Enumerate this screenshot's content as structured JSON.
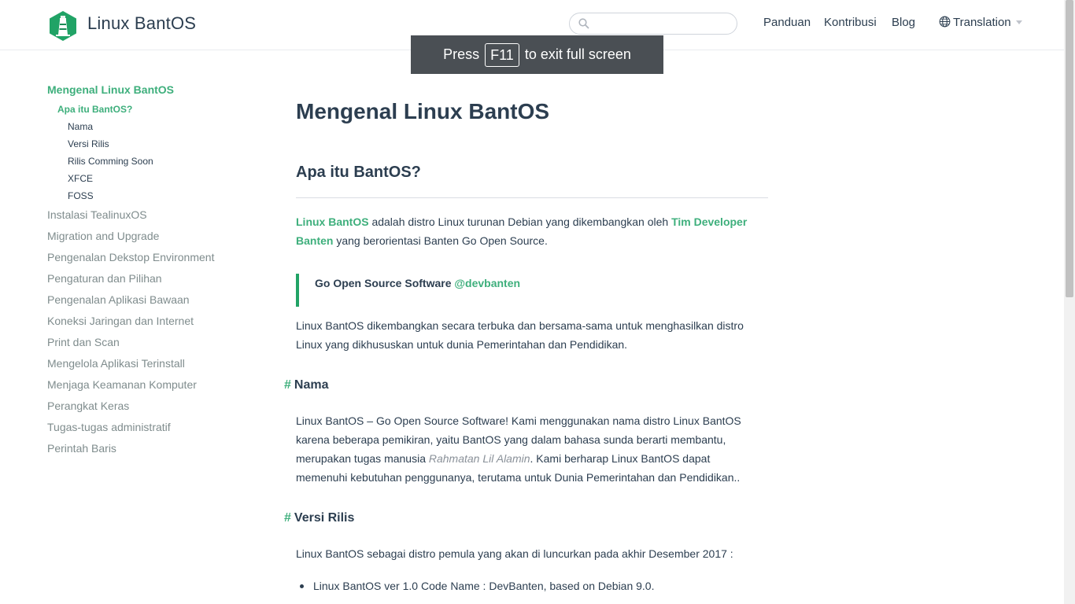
{
  "header": {
    "site_name": "Linux BantOS",
    "search_placeholder": "",
    "nav": [
      "Panduan",
      "Kontribusi",
      "Blog"
    ],
    "translation_label": "Translation"
  },
  "fullscreen_toast": {
    "press": "Press",
    "key": "F11",
    "suffix": "to exit full screen"
  },
  "sidebar": {
    "group_title": "Mengenal Linux BantOS",
    "sub_title": "Apa itu BantOS?",
    "sub_items": [
      "Nama",
      "Versi Rilis",
      "Rilis Comming Soon",
      "XFCE",
      "FOSS"
    ],
    "items": [
      "Instalasi TealinuxOS",
      "Migration and Upgrade",
      "Pengenalan Dekstop Environment",
      "Pengaturan dan Pilihan",
      "Pengenalan Aplikasi Bawaan",
      "Koneksi Jaringan dan Internet",
      "Print dan Scan",
      "Mengelola Aplikasi Terinstall",
      "Menjaga Keamanan Komputer",
      "Perangkat Keras",
      "Tugas-tugas administratif",
      "Perintah Baris"
    ]
  },
  "content": {
    "h1": "Mengenal Linux BantOS",
    "h2": "Apa itu BantOS?",
    "intro": {
      "link1": "Linux BantOS",
      "text1": " adalah distro Linux turunan Debian yang dikembangkan oleh ",
      "link2_line1": "Tim Developer",
      "link2_line2": "Banten",
      "text2": " yang berorientasi Banten Go Open Source."
    },
    "quote": {
      "text": "Go Open Source Software ",
      "handle": "@devbanten"
    },
    "para2_line1": "Linux BantOS dikembangkan secara terbuka dan bersama-sama untuk menghasilkan distro",
    "para2_line2": "Linux yang dikhususkan untuk dunia Pemerintahan dan Pendidikan.",
    "anchor": "#",
    "section_nama": {
      "title": "Nama",
      "line1": "Linux BantOS – Go Open Source Software! Kami menggunakan nama distro Linux BantOS",
      "line2": "karena beberapa pemikiran, yaitu BantOS yang dalam bahasa sunda berarti membantu,",
      "line3_pre": "merupakan tugas manusia ",
      "line3_em": "Rahmatan Lil Alamin",
      "line3_post": ". Kami berharap Linux BantOS dapat",
      "line4": "memenuhi kebutuhan penggunanya, terutama untuk Dunia Pemerintahan dan Pendidikan.."
    },
    "section_versi": {
      "title": "Versi Rilis",
      "line1": "Linux BantOS sebagai distro pemula yang akan di luncurkan pada akhir Desember 2017 :",
      "list": [
        "Linux BantOS ver 1.0 Code Name : DevBanten, based on Debian 9.0."
      ]
    }
  },
  "colors": {
    "accent": "#3eaf7c",
    "text": "#2c3e50",
    "muted": "#7f8c8d",
    "logo_bg": "#21a366"
  }
}
